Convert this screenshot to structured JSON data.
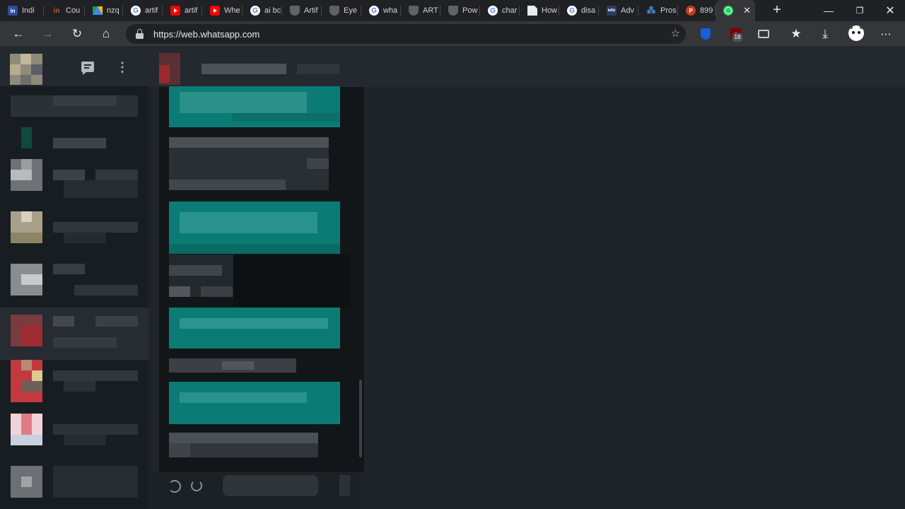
{
  "browser": {
    "tabs": [
      {
        "title": "Indi",
        "favicon": "indeed-icon",
        "width": 62
      },
      {
        "title": "Cou",
        "favicon": "coursera-icon",
        "width": 58
      },
      {
        "title": "nzq",
        "favicon": "drive-icon",
        "width": 54
      },
      {
        "title": "artif",
        "favicon": "google-icon",
        "width": 56
      },
      {
        "title": "artif",
        "favicon": "youtube-icon",
        "width": 56
      },
      {
        "title": "Whe",
        "favicon": "youtube-icon",
        "width": 57
      },
      {
        "title": "ai bc",
        "favicon": "google-icon",
        "width": 56
      },
      {
        "title": "Artif",
        "favicon": "shield-icon",
        "width": 56
      },
      {
        "title": "Eye",
        "favicon": "shield-icon",
        "width": 56
      },
      {
        "title": "wha",
        "favicon": "google-icon",
        "width": 56
      },
      {
        "title": "ART",
        "favicon": "shield-icon",
        "width": 56
      },
      {
        "title": "Pow",
        "favicon": "shield-icon",
        "width": 56
      },
      {
        "title": "char",
        "favicon": "google-icon",
        "width": 56
      },
      {
        "title": "How",
        "favicon": "document-icon",
        "width": 56
      },
      {
        "title": "disa",
        "favicon": "google-icon",
        "width": 56
      },
      {
        "title": "Adv",
        "favicon": "edu-icon",
        "width": 56
      },
      {
        "title": "Pros",
        "favicon": "feather-icon",
        "width": 56
      },
      {
        "title": "899",
        "favicon": "powerpoint-icon",
        "width": 53
      },
      {
        "title": "",
        "favicon": "whatsapp-icon",
        "width": 56,
        "active": true
      }
    ],
    "address": {
      "url": "https://web.whatsapp.com"
    },
    "extensions": {
      "ublock_badge": "18"
    }
  },
  "app": {
    "accent": "#0b7b75",
    "sidebar_bg": "#181d21",
    "panel_bg": "#1f242b"
  }
}
